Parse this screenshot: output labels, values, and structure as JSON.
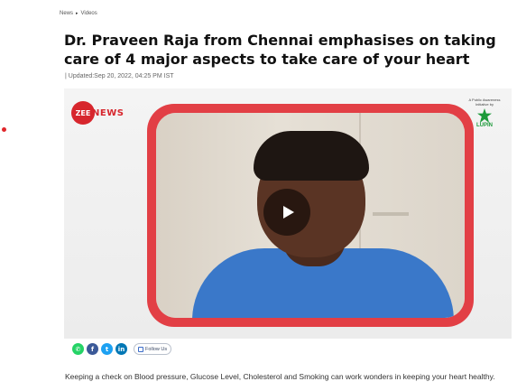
{
  "breadcrumb": {
    "items": [
      "News",
      "Videos"
    ],
    "separator": "▸"
  },
  "article": {
    "title": "Dr. Praveen Raja from Chennai emphasises on taking care of 4 major aspects to take care of your heart",
    "meta": "| Updated:Sep 20, 2022, 04:25 PM IST",
    "description": "Keeping a check on Blood pressure, Glucose Level, Cholesterol and Smoking can work wonders in keeping your heart healthy."
  },
  "video": {
    "logo_zee": "ZEE",
    "logo_news": "NEWS",
    "sponsor_text": "A Public Awareness Initiative by",
    "sponsor_name": "LUPIN",
    "play_icon": "play-icon"
  },
  "share": {
    "icons": [
      "whatsapp-icon",
      "facebook-icon",
      "twitter-icon",
      "linkedin-icon"
    ],
    "follow_label": "Follow Us"
  },
  "colors": {
    "accent_red": "#e0262b",
    "frame_red": "#e23f45",
    "whatsapp": "#25d366",
    "facebook": "#3b5998",
    "twitter": "#1da1f2",
    "linkedin": "#0077b5",
    "lupin_green": "#1d9a3a"
  }
}
